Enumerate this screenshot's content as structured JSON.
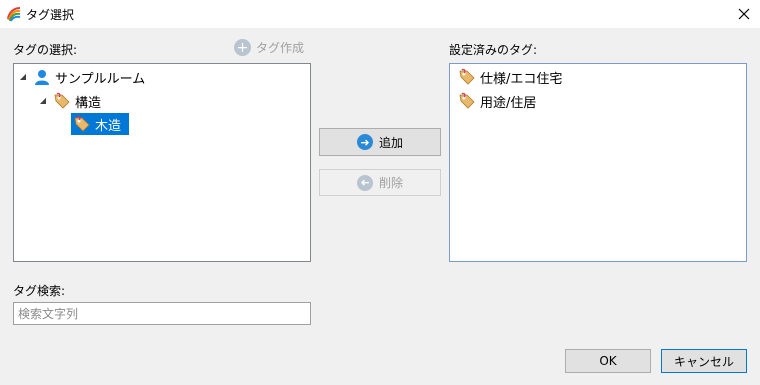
{
  "window": {
    "title": "タグ選択"
  },
  "left_panel": {
    "label": "タグの選択:",
    "create_tag_label": "タグ作成",
    "tree": {
      "root": {
        "label": "サンプルルーム",
        "icon": "user-icon"
      },
      "child": {
        "label": "構造",
        "icon": "tag-icon"
      },
      "grandchild": {
        "label": "木造",
        "icon": "tag-icon",
        "selected": true
      }
    }
  },
  "right_panel": {
    "label": "設定済みのタグ:",
    "items": [
      {
        "label": "仕様/エコ住宅",
        "icon": "tag-icon"
      },
      {
        "label": "用途/住居",
        "icon": "tag-icon"
      }
    ]
  },
  "actions": {
    "add_label": "追加",
    "remove_label": "削除"
  },
  "search": {
    "label": "タグ検索:",
    "placeholder": "検索文字列",
    "value": ""
  },
  "footer": {
    "ok_label": "OK",
    "cancel_label": "キャンセル"
  },
  "colors": {
    "selection": "#0078d7",
    "accent_button": "#2b8ad8",
    "disabled": "#a0a0a0",
    "user_icon": "#1e88e5",
    "tag_icon": "#e8b96a"
  }
}
